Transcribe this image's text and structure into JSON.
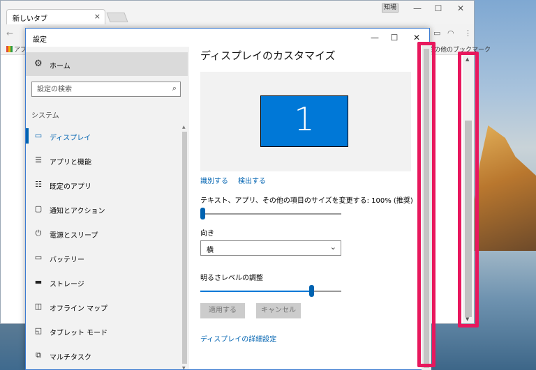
{
  "browser": {
    "tab_title": "新しいタブ",
    "tab_close": "×",
    "user_badge": "知場",
    "window_minimize": "—",
    "window_maximize": "☐",
    "window_close": "✕",
    "back": "←",
    "apps_label": "アプ",
    "other_bookmarks": "その他のブックマーク",
    "menu": "⋮"
  },
  "settings": {
    "window_title": "設定",
    "minimize": "—",
    "maximize": "☐",
    "close": "✕",
    "nav": {
      "home_label": "ホーム",
      "search_placeholder": "設定の検索",
      "section_label": "システム",
      "items": [
        {
          "label": "ディスプレイ",
          "icon": "monitor-icon",
          "selected": true
        },
        {
          "label": "アプリと機能",
          "icon": "list-icon",
          "selected": false
        },
        {
          "label": "既定のアプリ",
          "icon": "default-apps-icon",
          "selected": false
        },
        {
          "label": "通知とアクション",
          "icon": "notification-icon",
          "selected": false
        },
        {
          "label": "電源とスリープ",
          "icon": "power-icon",
          "selected": false
        },
        {
          "label": "バッテリー",
          "icon": "battery-icon",
          "selected": false
        },
        {
          "label": "ストレージ",
          "icon": "storage-icon",
          "selected": false
        },
        {
          "label": "オフライン マップ",
          "icon": "map-icon",
          "selected": false
        },
        {
          "label": "タブレット モード",
          "icon": "tablet-icon",
          "selected": false
        },
        {
          "label": "マルチタスク",
          "icon": "multitask-icon",
          "selected": false
        }
      ]
    },
    "main": {
      "title": "ディスプレイのカスタマイズ",
      "monitor_number": "1",
      "identify_link": "識別する",
      "detect_link": "検出する",
      "scale_label": "テキスト、アプリ、その他の項目のサイズを変更する: 100% (推奨)",
      "scale_level": 0,
      "orientation_label": "向き",
      "orientation_value": "横",
      "brightness_label": "明るさレベルの調整",
      "brightness_level": 0.8,
      "apply_button": "適用する",
      "cancel_button": "キャンセル",
      "advanced_link": "ディスプレイの詳細設定"
    }
  },
  "colors": {
    "accent": "#0078d7",
    "link": "#0063b1",
    "highlight": "#e8175d"
  }
}
